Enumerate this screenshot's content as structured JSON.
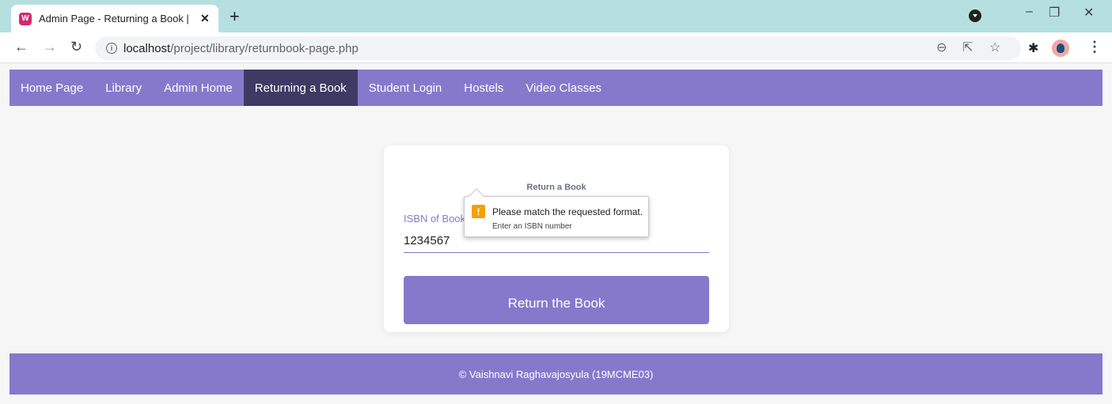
{
  "browser": {
    "tab": {
      "title": "Admin Page - Returning a Book |",
      "favicon": "wamp-icon",
      "favicon_color": "#d6266f"
    },
    "new_tab_symbol": "+",
    "close_tab_symbol": "✕",
    "window_controls": {
      "minimize": "–",
      "restore": "❐",
      "close": "✕"
    },
    "url": {
      "host": "localhost",
      "path": "/project/library/returnbook-page.php"
    },
    "icons": [
      "zoom-icon",
      "share-icon",
      "bookmark-star-icon",
      "extensions-icon",
      "profile-avatar",
      "menu-icon"
    ],
    "chrome_color": "#b6e0e0"
  },
  "nav": {
    "items": [
      {
        "label": "Home Page",
        "active": false
      },
      {
        "label": "Library",
        "active": false
      },
      {
        "label": "Admin Home",
        "active": false
      },
      {
        "label": "Returning a Book",
        "active": true
      },
      {
        "label": "Student Login",
        "active": false
      },
      {
        "label": "Hostels",
        "active": false
      },
      {
        "label": "Video Classes",
        "active": false
      }
    ],
    "color": "#8679cc",
    "active_color": "#3e3a63"
  },
  "form": {
    "title": "Return a Book",
    "field_label": "ISBN of Book",
    "field_value": "1234567",
    "button_label": "Return the Book"
  },
  "validation": {
    "message": "Please match the requested format.",
    "hint": "Enter an ISBN number",
    "icon": "warning-icon"
  },
  "footer": {
    "text": "© Vaishnavi Raghavajosyula (19MCME03)"
  }
}
